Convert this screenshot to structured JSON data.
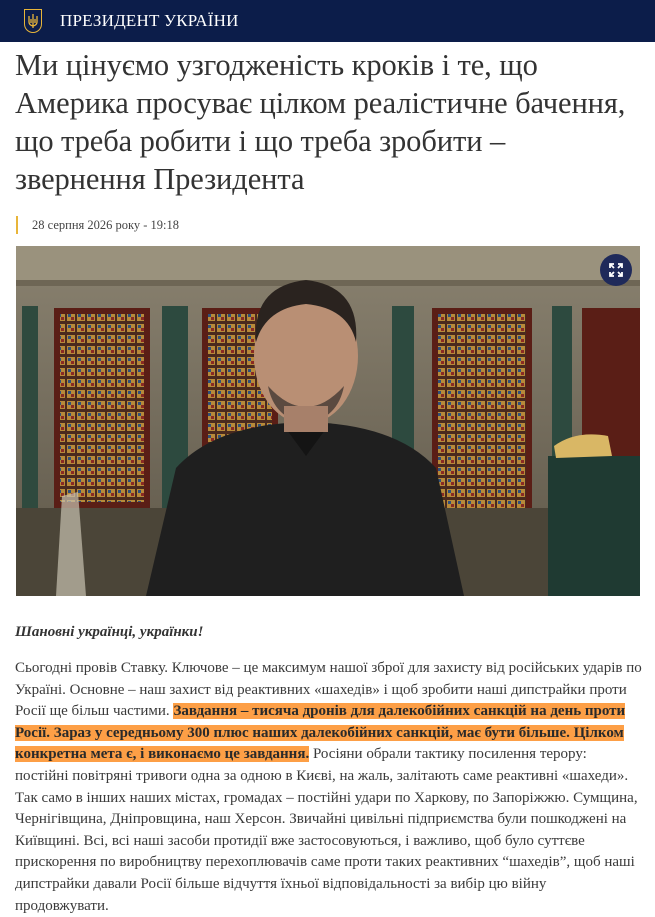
{
  "header": {
    "site_name": "ПРЕЗИДЕНТ УКРАЇНИ",
    "colors": {
      "background": "#0c1d4a",
      "accent": "#e8b53a"
    }
  },
  "article": {
    "title": "Ми цінуємо узгодженість кроків і те, що Америка просуває цілком реалістичне бачення, що треба робити і що треба зробити – звернення Президента",
    "date": "28 серпня 2026 року - 19:18",
    "image_expand_icon": "expand-icon",
    "greeting": "Шановні українці, українки!",
    "paragraph": {
      "before": "Сьогодні провів Ставку. Ключове – це максимум нашої зброї для захисту від російських ударів по Україні. Основне – наш захист від реактивних «шахедів» і щоб зробити наші дипстрайки проти Росії ще більш частими. ",
      "highlight": "Завдання – тисяча дронів для далекобійних санкцій на день проти Росії. Зараз у середньому 300 плюс наших далекобійних санкцій, має бути більше. Цілком конкретна мета є, і виконаємо це завдання.",
      "after": " Росіяни обрали тактику посилення терору: постійні повітряні тривоги одна за одною в Києві, на жаль, залітають саме реактивні «шахеди». Так само в інших наших містах, громадах – постійні удари по Харкову, по Запоріжжю. Сумщина, Чернігівщина, Дніпровщина, наш Херсон. Звичайні цивільні підприємства були пошкоджені на Київщині. Всі, всі наші засоби протидії вже застосовуються, і важливо, щоб було суттєве прискорення по виробництву перехоплювачів саме проти таких реактивних “шахедів”, щоб наші дипстрайки давали Росії більше відчуття їхньої відповідальності за вибір цю війну продовжувати.",
      "highlight_color": "#fd9f46"
    }
  }
}
